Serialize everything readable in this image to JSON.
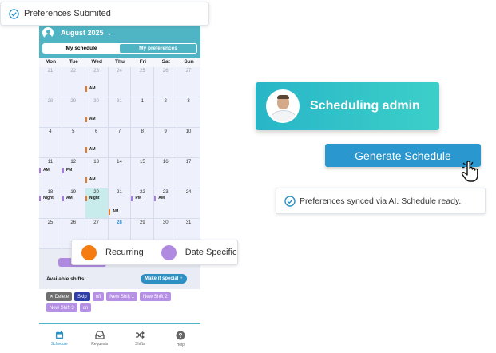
{
  "toast_top": {
    "text": "Preferences Submited",
    "icon": "check-circle-icon"
  },
  "phone": {
    "month": "August 2025",
    "segments": [
      "My schedule",
      "My preferences"
    ],
    "weekdays": [
      "Mon",
      "Tue",
      "Wed",
      "Thu",
      "Fri",
      "Sat",
      "Sun"
    ],
    "weeks": [
      [
        "21",
        "22",
        "23",
        "24",
        "25",
        "26",
        "27"
      ],
      [
        "28",
        "29",
        "30",
        "31",
        "1",
        "2",
        "3"
      ],
      [
        "4",
        "5",
        "6",
        "7",
        "8",
        "9",
        "10"
      ],
      [
        "11",
        "12",
        "13",
        "14",
        "15",
        "16",
        "17"
      ],
      [
        "18",
        "19",
        "20",
        "21",
        "22",
        "23",
        "24"
      ],
      [
        "25",
        "26",
        "27",
        "28",
        "29",
        "30",
        "31"
      ]
    ],
    "tags": {
      "am": "AM",
      "pm": "PM",
      "night": "Night"
    },
    "available_label": "Available shifts:",
    "make_special": "Make it special +",
    "chips": {
      "delete": "✕ Delete",
      "skip": "Skip",
      "off": "off",
      "shift1": "New Shift 1",
      "shift2": "New Shift 2",
      "shift3": "New Shift 3",
      "on": "on"
    },
    "tabs": [
      "Schedule",
      "Requests",
      "Shifts",
      "Help"
    ]
  },
  "legend": {
    "recurring": "Recurring",
    "date_specific": "Date Specific"
  },
  "admin": {
    "title": "Scheduling admin"
  },
  "generate": {
    "label": "Generate Schedule"
  },
  "toast_sync": {
    "text": "Preferences synced via AI. Schedule ready.",
    "icon": "check-circle-icon"
  },
  "colors": {
    "teal": "#4fb4c3",
    "orange": "#f47c10",
    "purple": "#b08ae0",
    "button_blue": "#2a98cf"
  }
}
